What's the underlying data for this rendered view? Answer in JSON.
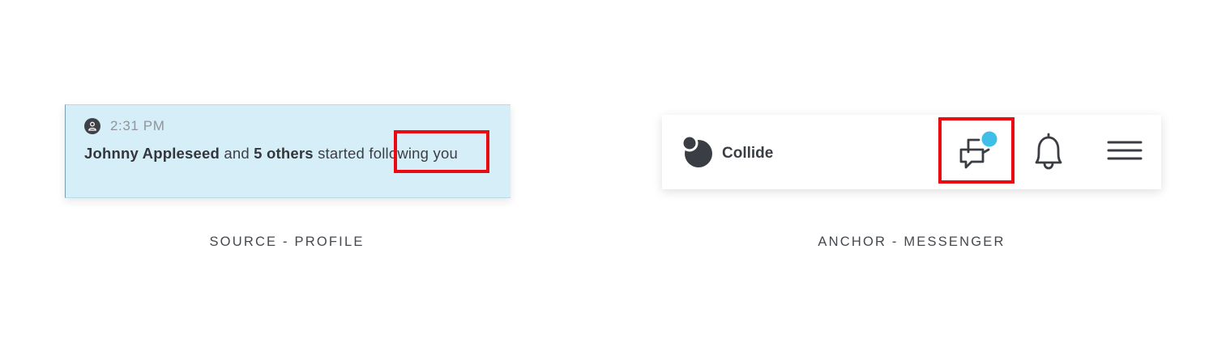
{
  "source": {
    "notification": {
      "time": "2:31 PM",
      "actor": "Johnny Appleseed",
      "connector": " and ",
      "others": "5 others",
      "action_before": " started ",
      "action_highlight": "following",
      "action_after": " you"
    },
    "caption": "SOURCE - PROFILE"
  },
  "anchor": {
    "brand": {
      "name": "Collide",
      "logo_icon": "collide-logo-icon"
    },
    "icons": [
      "messenger-icon",
      "bell-icon",
      "hamburger-menu-icon"
    ],
    "messenger_badge_color": "#3fbfe8",
    "caption": "ANCHOR - MESSENGER"
  },
  "colors": {
    "highlight": "#ea0b12",
    "card_background": "#d5eef7",
    "icon_dark": "#3a3d43"
  }
}
